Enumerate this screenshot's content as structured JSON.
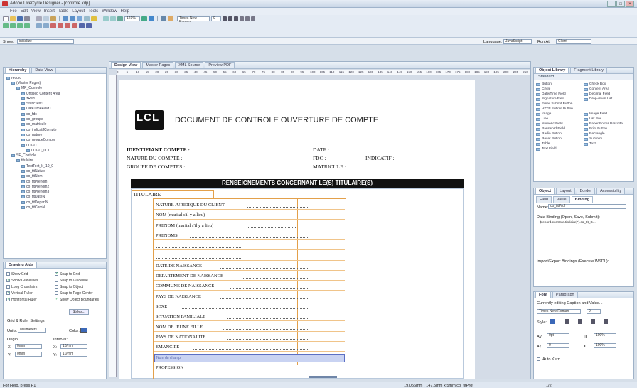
{
  "window": {
    "title": "Adobe LiveCycle Designer - [controle.xdp]",
    "buttons": [
      "–",
      "□",
      "×"
    ]
  },
  "menu": [
    "File",
    "Edit",
    "View",
    "Insert",
    "Table",
    "Layout",
    "Tools",
    "Window",
    "Help"
  ],
  "toolbar": {
    "zoom": "121%",
    "font": "Times New Roman",
    "font_size": "9"
  },
  "actionbar": {
    "show_label": "Show:",
    "show_value": "initialize",
    "language_label": "Language:",
    "language_value": "JavaScript",
    "run_at_label": "Run At:",
    "run_at_value": "Client"
  },
  "left_top": {
    "tabs": [
      "Hierarchy",
      "Data View"
    ],
    "tree": [
      "record",
      "(Master Pages)",
      "MP_Controle",
      "Untitled Content Area",
      "zRed",
      "StaticText1",
      "DateTimeField1",
      "co_fdc",
      "co_groupe",
      "co_matricule",
      "co_indicatifCompte",
      "co_nature",
      "co_groupeCompte",
      "LOGO",
      "LOGO_LCL",
      "SF_Controle",
      "titulaire",
      "TextText_Ir_10_0",
      "co_titNature",
      "co_titNom",
      "co_titPrenom",
      "co_titPrenom2",
      "co_titPrenom3",
      "co_titDateN",
      "co_titDepartN",
      "co_titComN"
    ]
  },
  "drawing_aids": {
    "title": "Drawing Aids",
    "options": [
      {
        "label": "Show Grid",
        "checked": false
      },
      {
        "label": "Snap to Grid",
        "checked": true
      },
      {
        "label": "Show Guidelines",
        "checked": true
      },
      {
        "label": "Snap to Guideline",
        "checked": false
      },
      {
        "label": "Long Crosshairs",
        "checked": false
      },
      {
        "label": "Snap to Object",
        "checked": false
      },
      {
        "label": "Vertical Ruler",
        "checked": true
      },
      {
        "label": "Snap to Page Center",
        "checked": false
      },
      {
        "label": "Horizontal Ruler",
        "checked": true
      },
      {
        "label": "Show Object Boundaries",
        "checked": true
      }
    ],
    "styles_button": "Styles...",
    "grid_settings": "Grid & Ruler Settings",
    "units_label": "Units:",
    "units_value": "Millimeters",
    "color_label": "Color:",
    "origin_label": "Origin:",
    "interval_label": "Interval:",
    "origin_x": "0mm",
    "origin_y": "0mm",
    "interval_x": "10/mm",
    "interval_y": "10/mm"
  },
  "editor": {
    "tabs": [
      "Design View",
      "Master Pages",
      "XML Source",
      "Preview PDF"
    ],
    "ruler": [
      "0",
      "5",
      "10",
      "15",
      "20",
      "25",
      "30",
      "35",
      "40",
      "45",
      "50",
      "55",
      "60",
      "65",
      "70",
      "75",
      "80",
      "85",
      "90",
      "95",
      "100",
      "105",
      "110",
      "115",
      "120",
      "125",
      "130",
      "135",
      "140",
      "145",
      "150",
      "155",
      "160",
      "165",
      "170",
      "175",
      "180",
      "185",
      "190",
      "195",
      "200",
      "205",
      "210"
    ]
  },
  "document": {
    "logo": "LCL",
    "title": "DOCUMENT DE CONTROLE OUVERTURE DE COMPTE",
    "id_label": "IDENTIFIANT COMPTE :",
    "date_label": "DATE :",
    "nature_label": "NATURE DU COMPTE :",
    "fdc_label": "FDC :",
    "indicatif_label": "INDICATIF :",
    "groupe_label": "GROUPE DE COMPTES :",
    "matricule_label": "MATRICULE :",
    "section_banner": "RENSEIGNEMENTS CONCERNANT LE(S) TITULAIRE(S)",
    "titulaire": "TITULAIRE",
    "fields": [
      "NATURE JURIDIQUE DU CLIENT",
      "NOM (marital s'il y a lieu)",
      "PRENOM (marital s'il y a lieu)",
      "PRENOMS",
      "",
      "",
      "DATE DE NAISSANCE",
      "DEPARTEMENT DE NAISSANCE",
      "COMMUNE DE NAISSANCE",
      "PAYS DE NAISSANCE",
      "SEXE",
      "SITUATION FAMILIALE",
      "NOM DE JEUNE FILLE",
      "PAYS DE NATIONALITE",
      "EMANCIPE",
      "Nom du champ",
      "PROFESSION"
    ]
  },
  "object_library": {
    "tabs": [
      "Object Library",
      "Fragment Library"
    ],
    "group": "Standard",
    "items": [
      "Button",
      "Check Box",
      "Circle",
      "Content Area",
      "Date/Time Field",
      "Decimal Field",
      "Signature Field",
      "Drop-down List",
      "Email Submit Button",
      "",
      "HTTP Submit Button",
      "",
      "Image",
      "Image Field",
      "Line",
      "List Box",
      "Numeric Field",
      "Paper Forms Barcode",
      "Password Field",
      "Print Button",
      "Radio Button",
      "Rectangle",
      "Reset Button",
      "Subform",
      "Table",
      "Text",
      "Text Field",
      ""
    ]
  },
  "object_panel": {
    "tabs": [
      "Object",
      "Layout",
      "Border",
      "Accessibility"
    ],
    "subtabs": [
      "Field",
      "Value",
      "Binding"
    ],
    "name_label": "Name:",
    "name_value": "co_titProf",
    "binding_label": "Data Binding (Open, Save, Submit):",
    "binding_value": "$record.controle.titulaire[*].co_tit_B...",
    "import_label": "Import/Export Bindings (Execute WSDL):"
  },
  "font_panel": {
    "tabs": [
      "Font",
      "Paragraph"
    ],
    "editing": "Currently editing Caption and Value...",
    "font": "Times New Roman",
    "size": "9",
    "style_label": "Style:",
    "kern_value": "0pt",
    "scale_v": "100%",
    "baseline": "0",
    "scale_h": "100%",
    "auto_kern": "Auto Kern"
  },
  "status": {
    "help": "For Help, press F1",
    "coords": "19.056mm , 147.5mm x 5mm co_titProf",
    "page": "1/2"
  }
}
